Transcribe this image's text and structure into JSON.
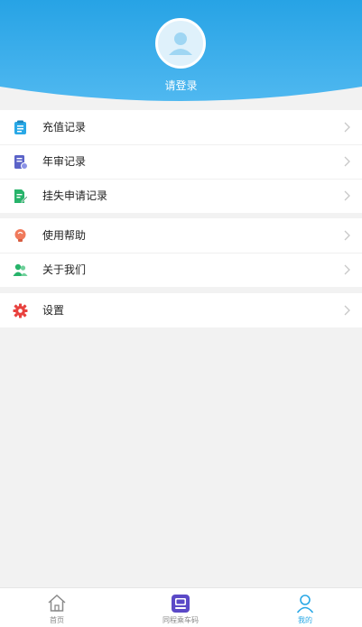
{
  "header": {
    "login_text": "请登录",
    "accent_color": "#29a8e6"
  },
  "menu": {
    "group1": [
      {
        "label": "充值记录",
        "icon": "clipboard-icon",
        "color": "#29a8e6"
      },
      {
        "label": "年审记录",
        "icon": "document-badge-icon",
        "color": "#5b63c8"
      },
      {
        "label": "挂失申请记录",
        "icon": "document-edit-icon",
        "color": "#27b36a"
      }
    ],
    "group2": [
      {
        "label": "使用帮助",
        "icon": "lightbulb-icon",
        "color": "#f07a5c"
      },
      {
        "label": "关于我们",
        "icon": "people-icon",
        "color": "#27b36a"
      }
    ],
    "group3": [
      {
        "label": "设置",
        "icon": "gear-icon",
        "color": "#e8413e"
      }
    ]
  },
  "tabbar": {
    "tabs": [
      {
        "label": "首页",
        "icon": "home-icon"
      },
      {
        "label": "同程乘车码",
        "icon": "bus-code-icon",
        "color": "#5b49c7"
      },
      {
        "label": "我的",
        "icon": "user-icon",
        "active": true
      }
    ]
  }
}
